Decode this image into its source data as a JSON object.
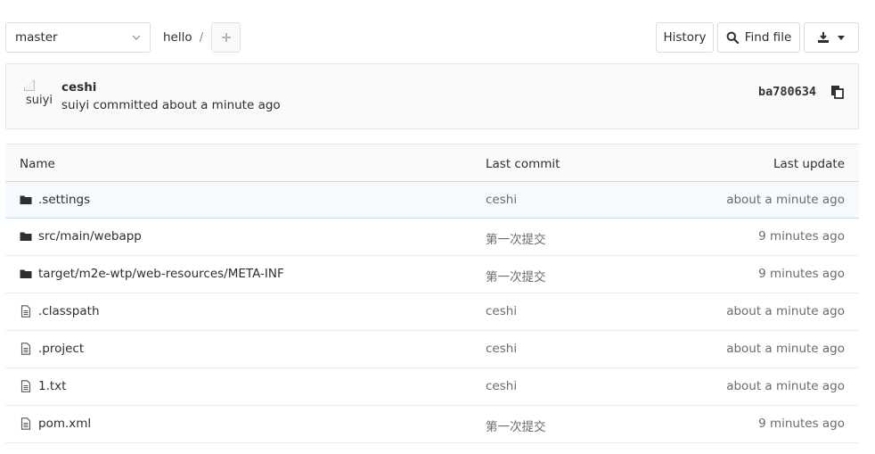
{
  "toolbar": {
    "branch": "master",
    "path": "hello",
    "path_sep": "/",
    "add_icon": "plus-icon",
    "history_label": "History",
    "find_label": "Find file",
    "find_icon": "search-icon",
    "download_icon": "download-icon"
  },
  "commit": {
    "avatar_alt": "suiyi",
    "title": "ceshi",
    "meta": "suiyi committed about a minute ago",
    "sha": "ba780634",
    "copy_icon": "copy-icon"
  },
  "table": {
    "headers": {
      "name": "Name",
      "last_commit": "Last commit",
      "last_update": "Last update"
    },
    "rows": [
      {
        "type": "folder",
        "icon": "folder-icon",
        "name": ".settings",
        "commit": "ceshi",
        "updated": "about a minute ago"
      },
      {
        "type": "folder",
        "icon": "folder-icon",
        "name": "src/main/webapp",
        "commit": "第一次提交",
        "updated": "9 minutes ago"
      },
      {
        "type": "folder",
        "icon": "folder-icon",
        "name": "target/m2e-wtp/web-resources/META-INF",
        "commit": "第一次提交",
        "updated": "9 minutes ago"
      },
      {
        "type": "file",
        "icon": "file-icon",
        "name": ".classpath",
        "commit": "ceshi",
        "updated": "about a minute ago"
      },
      {
        "type": "file",
        "icon": "file-icon",
        "name": ".project",
        "commit": "ceshi",
        "updated": "about a minute ago"
      },
      {
        "type": "file",
        "icon": "file-icon",
        "name": "1.txt",
        "commit": "ceshi",
        "updated": "about a minute ago"
      },
      {
        "type": "file",
        "icon": "file-icon",
        "name": "pom.xml",
        "commit": "第一次提交",
        "updated": "9 minutes ago"
      }
    ]
  },
  "colors": {
    "hover_row_bg": "#f6fafe",
    "hover_row_border": "#c7dcef",
    "header_bg": "#fafafa"
  }
}
